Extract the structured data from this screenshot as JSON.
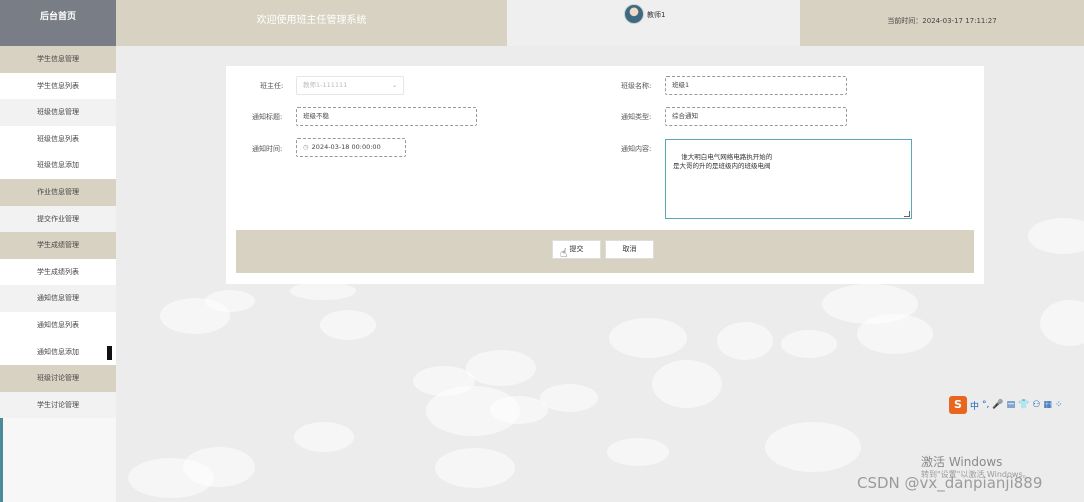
{
  "sidebar": {
    "brand": "后台首页",
    "items": [
      {
        "label": "学生信息管理",
        "type": "group"
      },
      {
        "label": "学生信息列表",
        "type": "sub"
      },
      {
        "label": "班级信息管理",
        "type": "plain"
      },
      {
        "label": "班级信息列表",
        "type": "sub"
      },
      {
        "label": "班级信息添加",
        "type": "sub"
      },
      {
        "label": "作业信息管理",
        "type": "group"
      },
      {
        "label": "提交作业管理",
        "type": "plain"
      },
      {
        "label": "学生成绩管理",
        "type": "group"
      },
      {
        "label": "学生成绩列表",
        "type": "sub"
      },
      {
        "label": "通知信息管理",
        "type": "plain"
      },
      {
        "label": "通知信息列表",
        "type": "sub"
      },
      {
        "label": "通知信息添加",
        "type": "sub"
      },
      {
        "label": "班级讨论管理",
        "type": "group"
      },
      {
        "label": "学生讨论管理",
        "type": "plain"
      }
    ]
  },
  "header": {
    "welcome": "欢迎使用班主任管理系统",
    "username": "教师1",
    "current_time": "当前时间：2024-03-17 17:11:27"
  },
  "form": {
    "teacher_label": "班主任:",
    "teacher_value": "教师1-111111",
    "class_name_label": "班级名称:",
    "class_name_value": "班级1",
    "title_label": "通知标题:",
    "title_value": "班级不稳",
    "type_label": "通知类型:",
    "type_value": "综合通知",
    "time_label": "通知时间:",
    "time_value": "2024-03-18 00:00:00",
    "content_label": "通知内容:",
    "content_value": "谁大明白电气网络电路执开始的\n是大哥的升的是班级内的班级电阀"
  },
  "actions": {
    "submit_label": "提交",
    "cancel_label": "取消"
  },
  "overlays": {
    "ime_logo": "S",
    "ime_items": [
      "中",
      "°,",
      "🎤",
      "▤",
      "👕",
      "⚇",
      "▦",
      "⁘"
    ],
    "windows_title": "激活 Windows",
    "windows_subtitle": "转到\"设置\"以激活 Windows。",
    "watermark": "CSDN @vx_danpianji889"
  },
  "colors": {
    "accent_beige": "#d8d2c2",
    "brand_gray": "#787d86",
    "teal_edge": "#4a8c9a",
    "textarea_border": "#5aa9b5"
  }
}
